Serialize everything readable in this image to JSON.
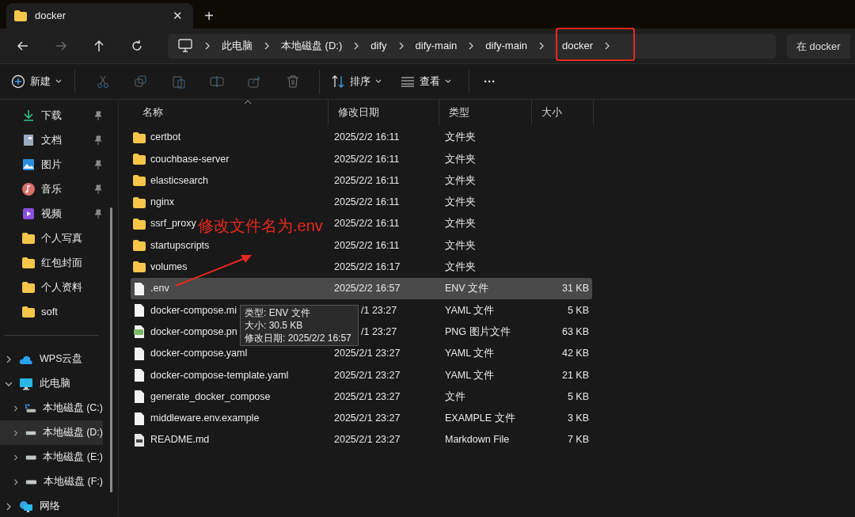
{
  "tab": {
    "title": "docker",
    "close": "✕",
    "new": "+"
  },
  "breadcrumb": [
    "此电脑",
    "本地磁盘 (D:)",
    "dify",
    "dify-main",
    "dify-main",
    "docker"
  ],
  "search": {
    "placeholder": "在 docker"
  },
  "toolbar": {
    "new": "新建",
    "sort": "排序",
    "view": "查看",
    "more": "···"
  },
  "sidebar": {
    "quick": [
      {
        "label": "下载",
        "kind": "download",
        "pinned": true
      },
      {
        "label": "文档",
        "kind": "document",
        "pinned": true
      },
      {
        "label": "图片",
        "kind": "picture",
        "pinned": true
      },
      {
        "label": "音乐",
        "kind": "music",
        "pinned": true
      },
      {
        "label": "视频",
        "kind": "video",
        "pinned": true
      },
      {
        "label": "个人写真",
        "kind": "folder",
        "pinned": false
      },
      {
        "label": "红包封面",
        "kind": "folder",
        "pinned": false
      },
      {
        "label": "个人资料",
        "kind": "folder",
        "pinned": false
      },
      {
        "label": "soft",
        "kind": "folder",
        "pinned": false
      }
    ],
    "tree": [
      {
        "label": "WPS云盘",
        "kind": "cloud",
        "expanded": false,
        "selected": false
      },
      {
        "label": "此电脑",
        "kind": "pc",
        "expanded": true,
        "selected": false,
        "children": [
          {
            "label": "本地磁盘 (C:)",
            "kind": "systemdrive",
            "expanded": false,
            "selected": false
          },
          {
            "label": "本地磁盘 (D:)",
            "kind": "drive",
            "expanded": false,
            "selected": true
          },
          {
            "label": "本地磁盘 (E:)",
            "kind": "drive",
            "expanded": false,
            "selected": false
          },
          {
            "label": "本地磁盘 (F:)",
            "kind": "drive",
            "expanded": false,
            "selected": false
          }
        ]
      },
      {
        "label": "网络",
        "kind": "network",
        "expanded": false,
        "selected": false
      }
    ]
  },
  "table": {
    "columns": [
      "名称",
      "修改日期",
      "类型",
      "大小"
    ],
    "rows": [
      {
        "name": "certbot",
        "date": "2025/2/2 16:11",
        "type": "文件夹",
        "kind": "folder",
        "selected": false,
        "covered": false
      },
      {
        "name": "couchbase-server",
        "date": "2025/2/2 16:11",
        "type": "文件夹",
        "kind": "folder",
        "selected": false,
        "covered": false
      },
      {
        "name": "elasticsearch",
        "date": "2025/2/2 16:11",
        "type": "文件夹",
        "kind": "folder",
        "selected": false,
        "covered": false
      },
      {
        "name": "nginx",
        "date": "2025/2/2 16:11",
        "type": "文件夹",
        "kind": "folder",
        "selected": false,
        "covered": false
      },
      {
        "name": "ssrf_proxy",
        "date": "2025/2/2 16:11",
        "type": "文件夹",
        "kind": "folder",
        "selected": false,
        "covered": false
      },
      {
        "name": "startupscripts",
        "date": "2025/2/2 16:11",
        "type": "文件夹",
        "kind": "folder",
        "selected": false,
        "covered": false
      },
      {
        "name": "volumes",
        "date": "2025/2/2 16:17",
        "type": "文件夹",
        "kind": "folder",
        "selected": false,
        "covered": false
      },
      {
        "name": ".env",
        "date": "2025/2/2 16:57",
        "type": "ENV 文件",
        "size": "31 KB",
        "kind": "file",
        "selected": true,
        "covered": false
      },
      {
        "name": "docker-compose.mi",
        "date": "/1 23:27",
        "type": "YAML 文件",
        "size": "5 KB",
        "kind": "file",
        "selected": false,
        "covered": true
      },
      {
        "name": "docker-compose.pn",
        "date": "/1 23:27",
        "type": "PNG 图片文件",
        "size": "63 KB",
        "kind": "image",
        "selected": false,
        "covered": true
      },
      {
        "name": "docker-compose.yaml",
        "date": "2025/2/1 23:27",
        "type": "YAML 文件",
        "size": "42 KB",
        "kind": "file",
        "selected": false,
        "covered": false
      },
      {
        "name": "docker-compose-template.yaml",
        "date": "2025/2/1 23:27",
        "type": "YAML 文件",
        "size": "21 KB",
        "kind": "file",
        "selected": false,
        "covered": false
      },
      {
        "name": "generate_docker_compose",
        "date": "2025/2/1 23:27",
        "type": "文件",
        "size": "5 KB",
        "kind": "file",
        "selected": false,
        "covered": false
      },
      {
        "name": "middleware.env.example",
        "date": "2025/2/1 23:27",
        "type": "EXAMPLE 文件",
        "size": "3 KB",
        "kind": "file",
        "selected": false,
        "covered": false
      },
      {
        "name": "README.md",
        "date": "2025/2/1 23:27",
        "type": "Markdown File",
        "size": "7 KB",
        "kind": "markdown",
        "selected": false,
        "covered": false
      }
    ]
  },
  "tooltip": [
    "类型: ENV 文件",
    "大小: 30.5 KB",
    "修改日期: 2025/2/2 16:57"
  ],
  "annotation": "修改文件名为.env"
}
